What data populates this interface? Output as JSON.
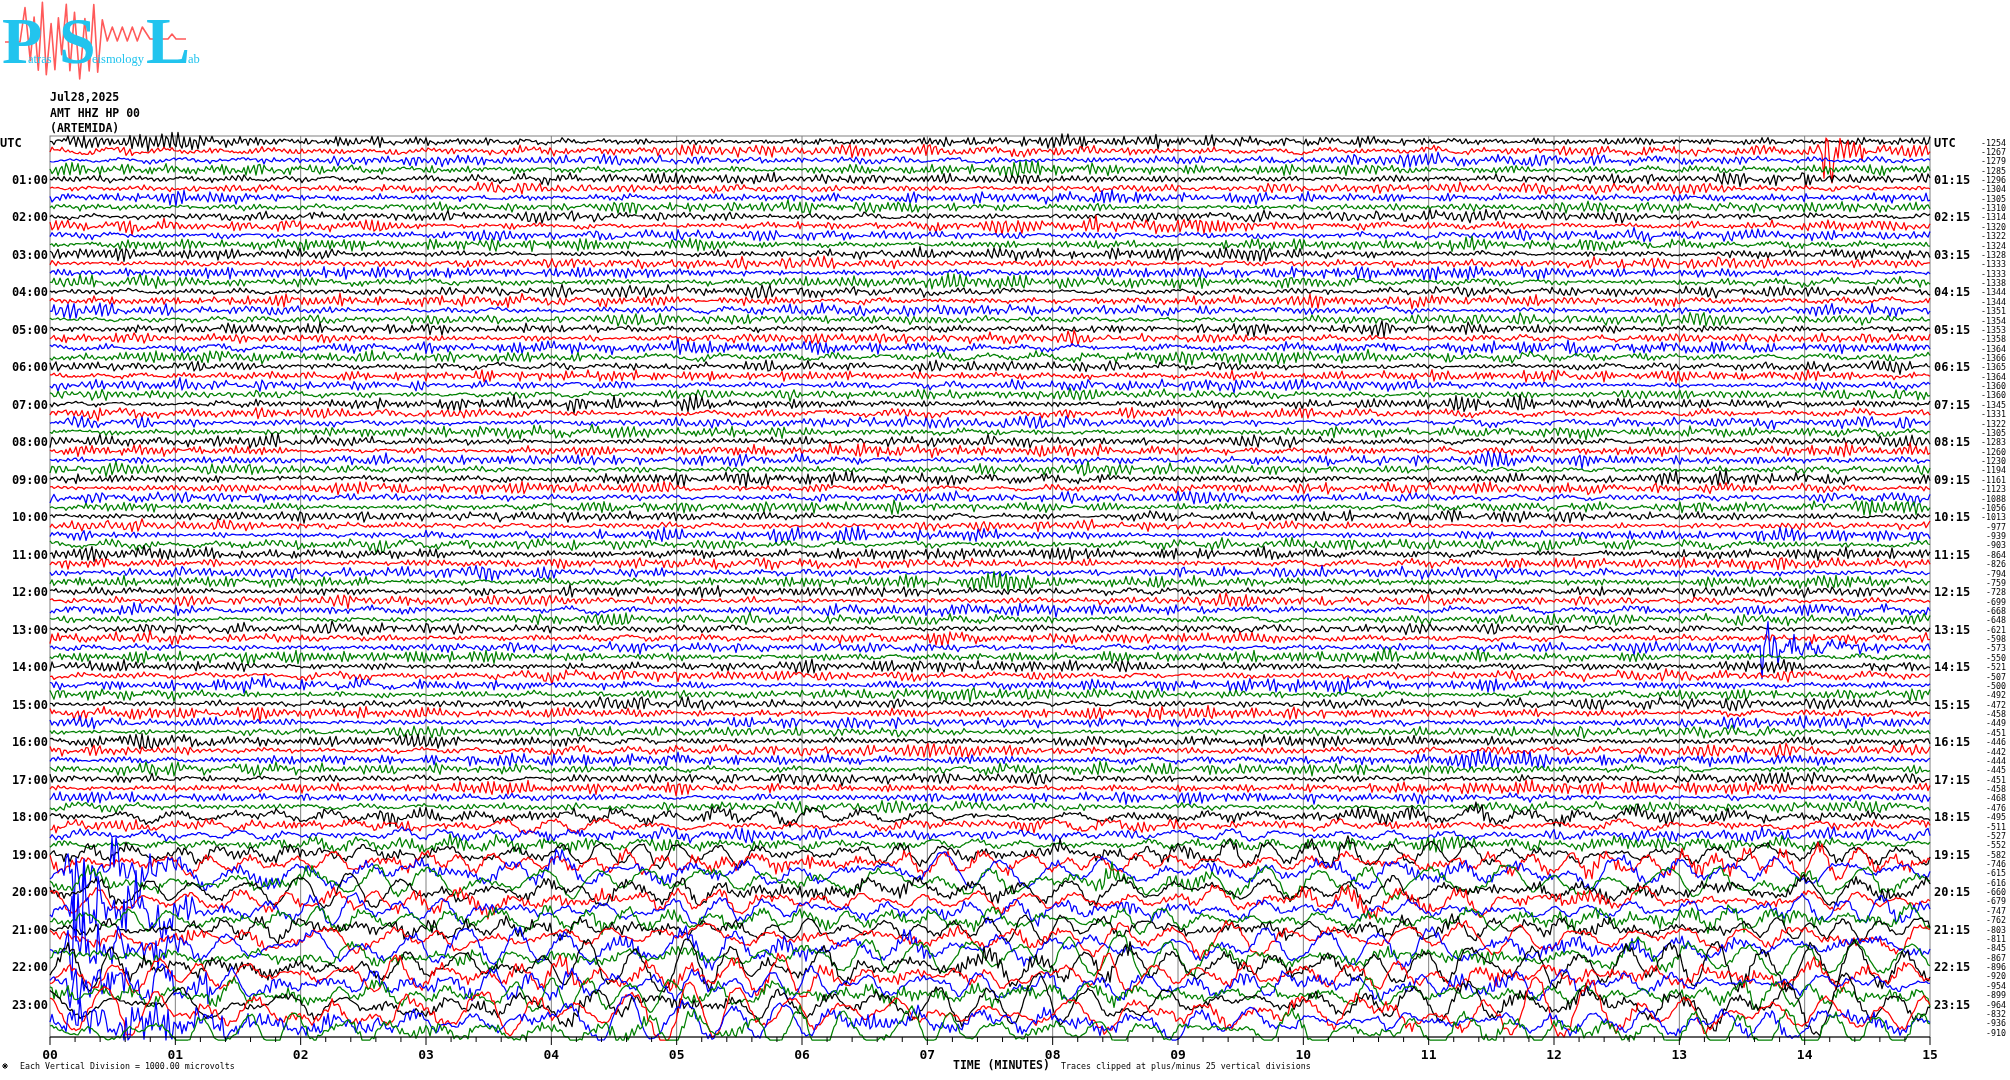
{
  "logo": {
    "parts": [
      {
        "initial": "P",
        "rest": "atras"
      },
      {
        "initial": "S",
        "rest": "eismology"
      },
      {
        "initial": "L",
        "rest": "ab"
      }
    ]
  },
  "header": {
    "date": "Jul28,2025",
    "channel": "AMT HHZ HP 00",
    "station": "(ARTEMIDA)"
  },
  "helicorder": {
    "traces": [
      {
        "color": "#000000",
        "reading": "-1254",
        "left_label": "UTC",
        "right_label": "UTC"
      },
      {
        "color": "#ff0000",
        "reading": "-1267"
      },
      {
        "color": "#0000ff",
        "reading": "-1279"
      },
      {
        "color": "#008000",
        "reading": "-1285"
      },
      {
        "color": "#000000",
        "reading": "-1296",
        "left_label": "01:00",
        "right_label": "01:15"
      },
      {
        "color": "#ff0000",
        "reading": "-1304"
      },
      {
        "color": "#0000ff",
        "reading": "-1305"
      },
      {
        "color": "#008000",
        "reading": "-1310"
      },
      {
        "color": "#000000",
        "reading": "-1314",
        "left_label": "02:00",
        "right_label": "02:15"
      },
      {
        "color": "#ff0000",
        "reading": "-1320"
      },
      {
        "color": "#0000ff",
        "reading": "-1322"
      },
      {
        "color": "#008000",
        "reading": "-1324"
      },
      {
        "color": "#000000",
        "reading": "-1328",
        "left_label": "03:00",
        "right_label": "03:15"
      },
      {
        "color": "#ff0000",
        "reading": "-1333"
      },
      {
        "color": "#0000ff",
        "reading": "-1333"
      },
      {
        "color": "#008000",
        "reading": "-1338"
      },
      {
        "color": "#000000",
        "reading": "-1344",
        "left_label": "04:00",
        "right_label": "04:15"
      },
      {
        "color": "#ff0000",
        "reading": "-1344"
      },
      {
        "color": "#0000ff",
        "reading": "-1351"
      },
      {
        "color": "#008000",
        "reading": "-1354"
      },
      {
        "color": "#000000",
        "reading": "-1353",
        "left_label": "05:00",
        "right_label": "05:15"
      },
      {
        "color": "#ff0000",
        "reading": "-1358"
      },
      {
        "color": "#0000ff",
        "reading": "-1364"
      },
      {
        "color": "#008000",
        "reading": "-1366"
      },
      {
        "color": "#000000",
        "reading": "-1365",
        "left_label": "06:00",
        "right_label": "06:15"
      },
      {
        "color": "#ff0000",
        "reading": "-1364"
      },
      {
        "color": "#0000ff",
        "reading": "-1360"
      },
      {
        "color": "#008000",
        "reading": "-1360"
      },
      {
        "color": "#000000",
        "reading": "-1345",
        "left_label": "07:00",
        "right_label": "07:15"
      },
      {
        "color": "#ff0000",
        "reading": "-1331"
      },
      {
        "color": "#0000ff",
        "reading": "-1322"
      },
      {
        "color": "#008000",
        "reading": "-1305"
      },
      {
        "color": "#000000",
        "reading": "-1283",
        "left_label": "08:00",
        "right_label": "08:15"
      },
      {
        "color": "#ff0000",
        "reading": "-1260"
      },
      {
        "color": "#0000ff",
        "reading": "-1230"
      },
      {
        "color": "#008000",
        "reading": "-1194"
      },
      {
        "color": "#000000",
        "reading": "-1161",
        "left_label": "09:00",
        "right_label": "09:15"
      },
      {
        "color": "#ff0000",
        "reading": "-1123"
      },
      {
        "color": "#0000ff",
        "reading": "-1088"
      },
      {
        "color": "#008000",
        "reading": "-1056"
      },
      {
        "color": "#000000",
        "reading": "-1013",
        "left_label": "10:00",
        "right_label": "10:15"
      },
      {
        "color": "#ff0000",
        "reading": "-977"
      },
      {
        "color": "#0000ff",
        "reading": "-939"
      },
      {
        "color": "#008000",
        "reading": "-903"
      },
      {
        "color": "#000000",
        "reading": "-864",
        "left_label": "11:00",
        "right_label": "11:15"
      },
      {
        "color": "#ff0000",
        "reading": "-826"
      },
      {
        "color": "#0000ff",
        "reading": "-794"
      },
      {
        "color": "#008000",
        "reading": "-759"
      },
      {
        "color": "#000000",
        "reading": "-728",
        "left_label": "12:00",
        "right_label": "12:15"
      },
      {
        "color": "#ff0000",
        "reading": "-699"
      },
      {
        "color": "#0000ff",
        "reading": "-668"
      },
      {
        "color": "#008000",
        "reading": "-648"
      },
      {
        "color": "#000000",
        "reading": "-621",
        "left_label": "13:00",
        "right_label": "13:15"
      },
      {
        "color": "#ff0000",
        "reading": "-598"
      },
      {
        "color": "#0000ff",
        "reading": "-573"
      },
      {
        "color": "#008000",
        "reading": "-550"
      },
      {
        "color": "#000000",
        "reading": "-521",
        "left_label": "14:00",
        "right_label": "14:15"
      },
      {
        "color": "#ff0000",
        "reading": "-507"
      },
      {
        "color": "#0000ff",
        "reading": "-500"
      },
      {
        "color": "#008000",
        "reading": "-492"
      },
      {
        "color": "#000000",
        "reading": "-472",
        "left_label": "15:00",
        "right_label": "15:15"
      },
      {
        "color": "#ff0000",
        "reading": "-458"
      },
      {
        "color": "#0000ff",
        "reading": "-449"
      },
      {
        "color": "#008000",
        "reading": "-451"
      },
      {
        "color": "#000000",
        "reading": "-446",
        "left_label": "16:00",
        "right_label": "16:15"
      },
      {
        "color": "#ff0000",
        "reading": "-442"
      },
      {
        "color": "#0000ff",
        "reading": "-444"
      },
      {
        "color": "#008000",
        "reading": "-445"
      },
      {
        "color": "#000000",
        "reading": "-451",
        "left_label": "17:00",
        "right_label": "17:15"
      },
      {
        "color": "#ff0000",
        "reading": "-458"
      },
      {
        "color": "#0000ff",
        "reading": "-468"
      },
      {
        "color": "#008000",
        "reading": "-476"
      },
      {
        "color": "#000000",
        "reading": "-495",
        "left_label": "18:00",
        "right_label": "18:15"
      },
      {
        "color": "#ff0000",
        "reading": "-511"
      },
      {
        "color": "#0000ff",
        "reading": "-527"
      },
      {
        "color": "#008000",
        "reading": "-552"
      },
      {
        "color": "#000000",
        "reading": "-582",
        "left_label": "19:00",
        "right_label": "19:15"
      },
      {
        "color": "#ff0000",
        "reading": "-746"
      },
      {
        "color": "#0000ff",
        "reading": "-615"
      },
      {
        "color": "#008000",
        "reading": "-616"
      },
      {
        "color": "#000000",
        "reading": "-660",
        "left_label": "20:00",
        "right_label": "20:15"
      },
      {
        "color": "#ff0000",
        "reading": "-679"
      },
      {
        "color": "#0000ff",
        "reading": "-747"
      },
      {
        "color": "#008000",
        "reading": "-762"
      },
      {
        "color": "#000000",
        "reading": "-803",
        "left_label": "21:00",
        "right_label": "21:15"
      },
      {
        "color": "#ff0000",
        "reading": "-811"
      },
      {
        "color": "#0000ff",
        "reading": "-845"
      },
      {
        "color": "#008000",
        "reading": "-867"
      },
      {
        "color": "#000000",
        "reading": "-896",
        "left_label": "22:00",
        "right_label": "22:15"
      },
      {
        "color": "#ff0000",
        "reading": "-920"
      },
      {
        "color": "#0000ff",
        "reading": "-954"
      },
      {
        "color": "#008000",
        "reading": "-899"
      },
      {
        "color": "#000000",
        "reading": "-964",
        "left_label": "23:00",
        "right_label": "23:15"
      },
      {
        "color": "#ff0000",
        "reading": "-832"
      },
      {
        "color": "#0000ff",
        "reading": "-936"
      },
      {
        "color": "#008000",
        "reading": "-910"
      }
    ],
    "x_tick_labels": [
      "00",
      "01",
      "02",
      "03",
      "04",
      "05",
      "06",
      "07",
      "08",
      "09",
      "10",
      "11",
      "12",
      "13",
      "14",
      "15"
    ],
    "xlabel": "TIME (MINUTES)",
    "scale_note": "Each Vertical Division = 1000.00 microvolts",
    "clip_note": "Traces clipped at plus/minus 25 vertical divisions"
  }
}
